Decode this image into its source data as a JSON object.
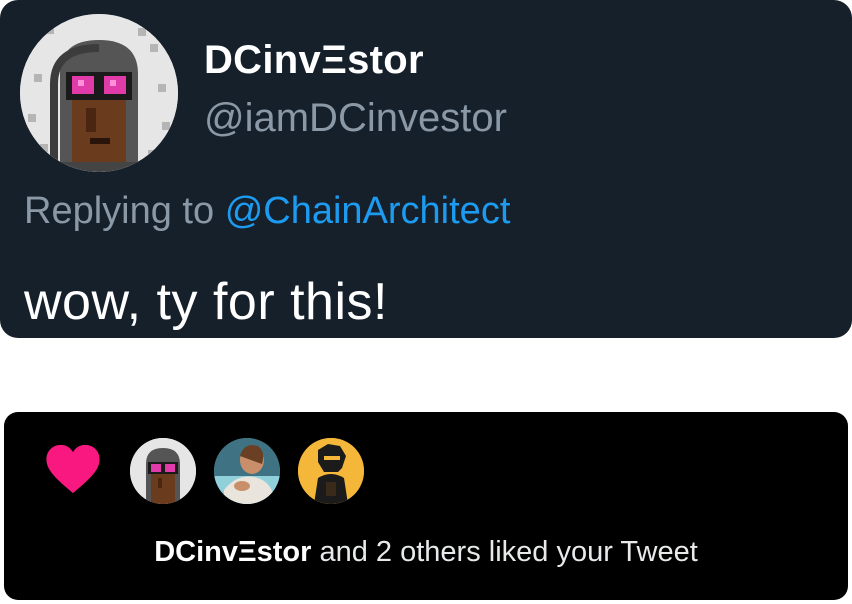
{
  "tweet": {
    "display_name": "DCinvΞstor",
    "handle": "@iamDCinvestor",
    "replying_prefix": "Replying to",
    "replying_to": "@ChainArchitect",
    "text": "wow, ty for this!"
  },
  "notification": {
    "icon": "heart-icon",
    "liker_name": "DCinvΞstor",
    "liked_text": "and 2 others liked your Tweet"
  },
  "colors": {
    "card_bg": "#15202b",
    "notif_bg": "#000000",
    "secondary_text": "#8b98a5",
    "mention": "#1d9bf0",
    "heart": "#f91880"
  }
}
